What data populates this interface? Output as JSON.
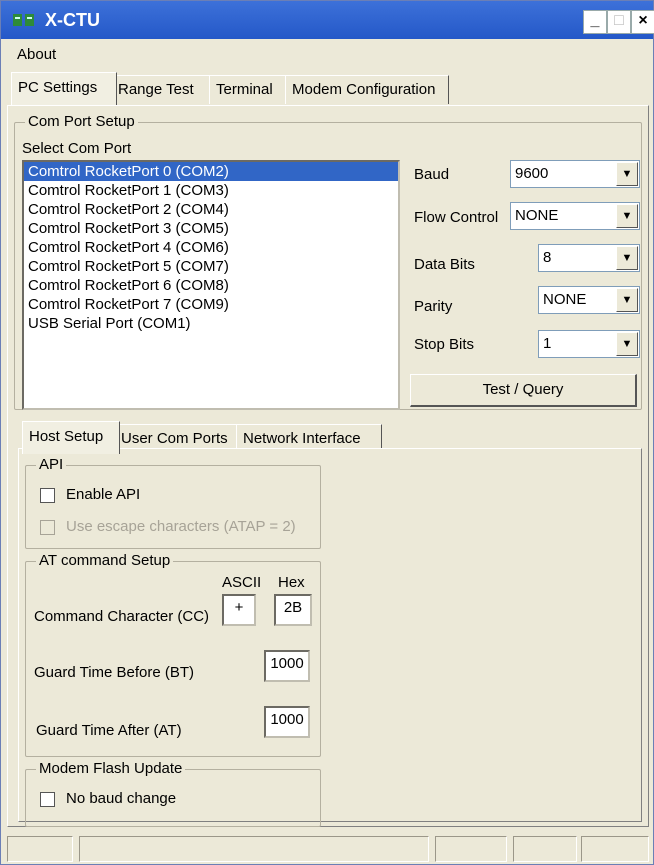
{
  "window": {
    "title": "X-CTU"
  },
  "titlebar": {
    "minimize": "_",
    "maximize": "□",
    "close": "×"
  },
  "menu": {
    "items": [
      "About"
    ]
  },
  "main_tabs": [
    "PC Settings",
    "Range Test",
    "Terminal",
    "Modem Configuration"
  ],
  "com_port_setup": {
    "group_label": "Com Port Setup",
    "select_label": "Select Com Port",
    "ports": [
      "Comtrol RocketPort 0 (COM2)",
      "Comtrol RocketPort 1 (COM3)",
      "Comtrol RocketPort 2 (COM4)",
      "Comtrol RocketPort 3 (COM5)",
      "Comtrol RocketPort 4 (COM6)",
      "Comtrol RocketPort 5 (COM7)",
      "Comtrol RocketPort 6 (COM8)",
      "Comtrol RocketPort 7 (COM9)",
      "USB Serial Port (COM1)"
    ],
    "selected_index": 0,
    "baud": {
      "label": "Baud",
      "value": "9600"
    },
    "flow_control": {
      "label": "Flow Control",
      "value": "NONE"
    },
    "data_bits": {
      "label": "Data Bits",
      "value": "8"
    },
    "parity": {
      "label": "Parity",
      "value": "NONE"
    },
    "stop_bits": {
      "label": "Stop Bits",
      "value": "1"
    },
    "test_query_label": "Test / Query"
  },
  "sub_tabs": [
    "Host Setup",
    "User Com Ports",
    "Network Interface"
  ],
  "api": {
    "group_label": "API",
    "enable_api": "Enable API",
    "use_escape": "Use escape characters (ATAP = 2)"
  },
  "at_command": {
    "group_label": "AT command Setup",
    "ascii_header": "ASCII",
    "hex_header": "Hex",
    "cc_label": "Command Character (CC)",
    "cc_ascii": "+",
    "cc_hex": "2B",
    "bt_label": "Guard Time Before (BT)",
    "bt_value": "1000",
    "at_label": "Guard Time After (AT)",
    "at_value": "1000"
  },
  "modem_flash": {
    "group_label": "Modem Flash Update",
    "no_baud_change": "No baud change"
  },
  "icons": {
    "app": "xctu-app-icon",
    "dropdown": "chevron-down-icon"
  },
  "colors": {
    "title_bar": "#2458c8",
    "selection": "#3166c6",
    "window_bg": "#ece9d8"
  }
}
